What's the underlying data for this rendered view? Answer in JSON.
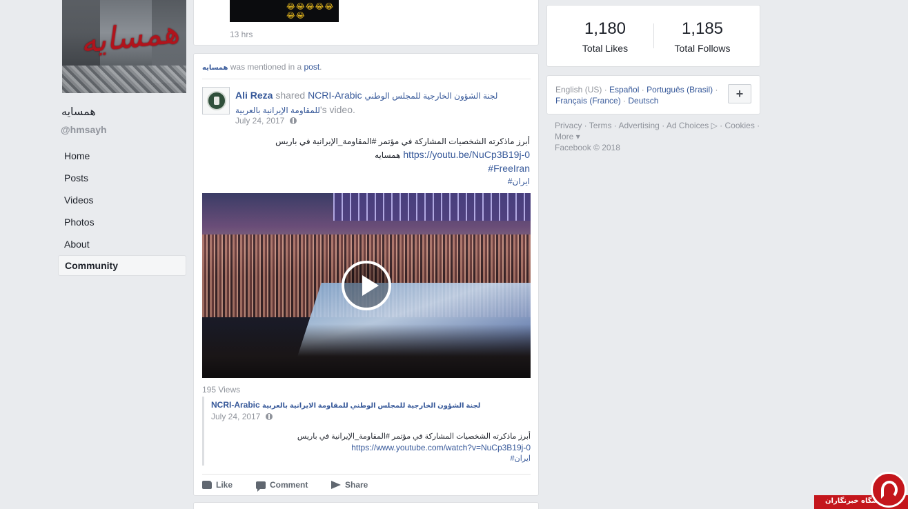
{
  "page": {
    "cover_text": "همسایه",
    "name": "همسایه",
    "handle": "@hmsayh"
  },
  "nav": {
    "items": [
      {
        "label": "Home"
      },
      {
        "label": "Posts"
      },
      {
        "label": "Videos"
      },
      {
        "label": "Photos"
      },
      {
        "label": "About"
      },
      {
        "label": "Community",
        "active": true
      }
    ]
  },
  "previous_post": {
    "emojis": "😂😂😂😂😂😂😂",
    "timestamp": "13 hrs"
  },
  "post": {
    "mention_page": "همسایه",
    "mention_text": "was mentioned in a",
    "mention_link": "post",
    "mention_end": ".",
    "author": "Ali Reza",
    "shared_word": "shared",
    "shared_page_latin": "NCRI-Arabic",
    "shared_page_arabic": "لجنة الشؤون الخارجية للمجلس الوطني للمقاومة الإيرانية بالعربية",
    "shared_suffix": "'s video.",
    "date": "July 24, 2017",
    "text_line1": "أبرز ماذكرته الشخصيات المشاركة في مؤتمر #المقاومة_الإيرانية في باريس",
    "text_line2_link": "https://youtu.be/NuCp3B19j-0",
    "text_line2_ar": "همسایه",
    "text_line3": "#FreeIran",
    "text_line4": "#ایران",
    "views": "195 Views",
    "quoted": {
      "title_latin": "NCRI-Arabic",
      "title_arabic": "لجنة الشؤون الخارجية للمجلس الوطني للمقاومة الايرانية بالعربية",
      "date": "July 24, 2017",
      "line1": "أبرز ماذكرته الشخصيات المشاركة في مؤتمر #المقاومة_الإيرانية في باريس",
      "line2_link": "https://www.youtube.com/watch?v=NuCp3B19j-0",
      "line3": "#ایران"
    },
    "actions": {
      "like": "Like",
      "comment": "Comment",
      "share": "Share"
    }
  },
  "stats": {
    "likes_count": "1,180",
    "likes_label": "Total Likes",
    "follows_count": "1,185",
    "follows_label": "Total Follows"
  },
  "languages": {
    "current": "English (US)",
    "others": [
      "Español",
      "Português (Brasil)",
      "Français (France)",
      "Deutsch"
    ],
    "add_label": "+"
  },
  "footer": {
    "links": [
      "Privacy",
      "Terms",
      "Advertising",
      "Ad Choices",
      "Cookies",
      "More"
    ],
    "copyright": "Facebook © 2018"
  },
  "watermark": {
    "text": "باشگاه خبرنگاران"
  }
}
